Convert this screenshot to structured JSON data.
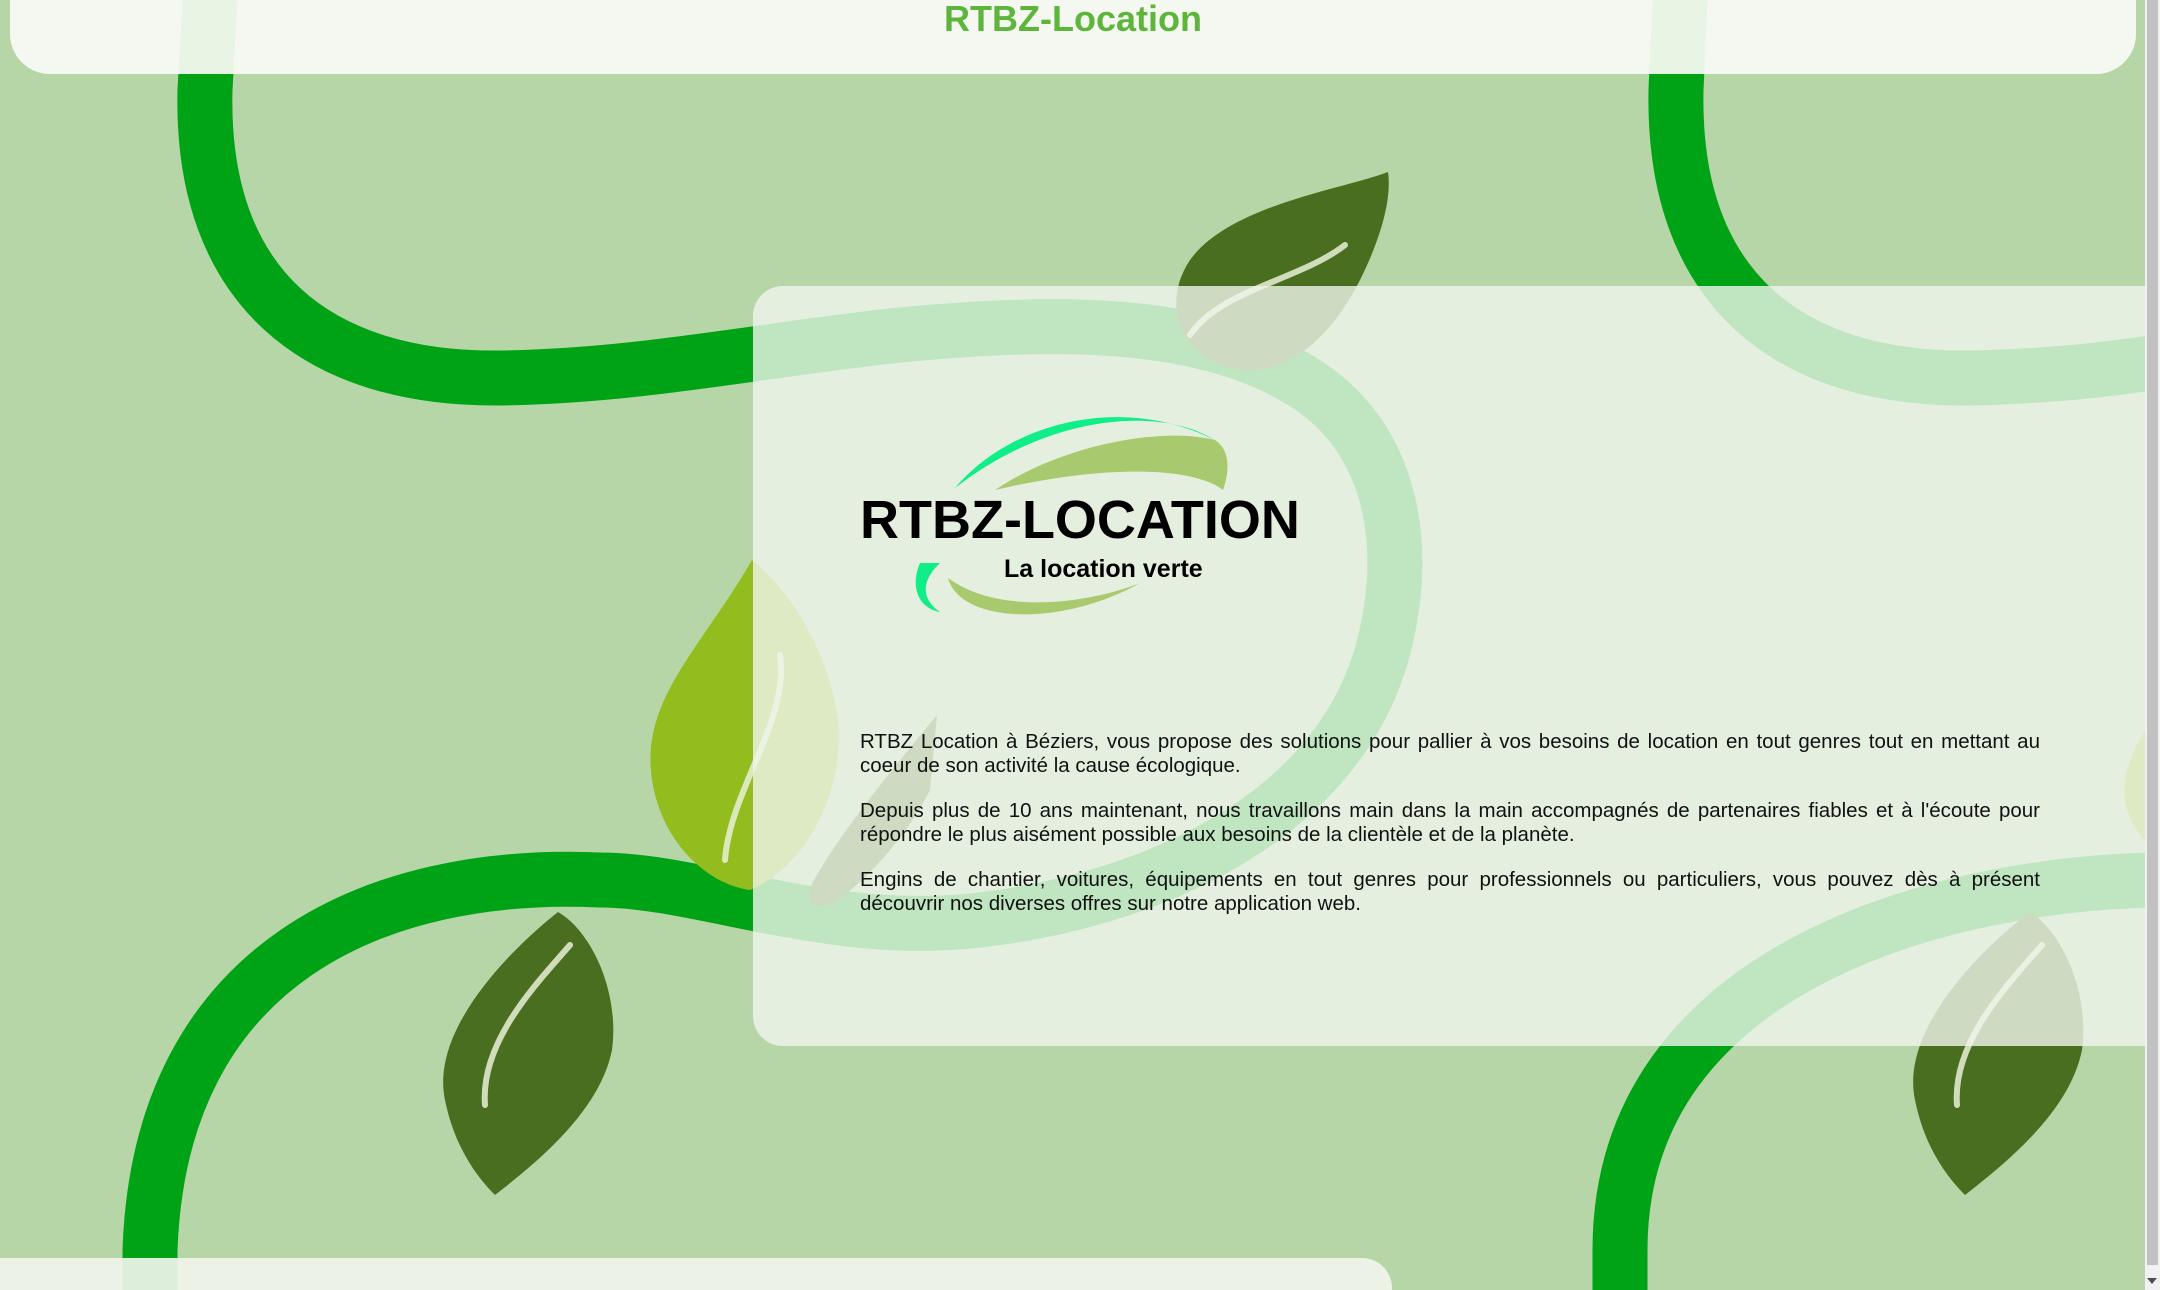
{
  "header": {
    "title": "RTBZ-Location"
  },
  "logo": {
    "name": "RTBZ-LOCATION",
    "tagline": "La location verte"
  },
  "intro": {
    "paragraphs": [
      "RTBZ Location à Béziers, vous propose des solutions pour pallier à vos besoins de location en tout genres tout en mettant au coeur de son activité la cause écologique.",
      "Depuis plus de 10 ans maintenant, nous travaillons main dans la main accompagnés de partenaires fiables et à l'écoute pour répondre le plus aisément possible aux besoins de la clientèle et de la planète.",
      "Engins de chantier, voitures, équipements en tout genres pour professionnels ou particuliers, vous pouvez dès à présent découvrir nos diverses offres sur notre application web."
    ]
  },
  "colors": {
    "background": "#b7d6a8",
    "vine": "#00a316",
    "leaf_dark": "#4a6e20",
    "leaf_light": "#93bd1e",
    "title_green": "#5db53c",
    "logo_swoosh_mint": "#10ee88",
    "logo_swoosh_olive": "#a9c96e"
  },
  "icons": {
    "logo": "swoosh-logo-icon",
    "decor": "leaf-vine-pattern"
  }
}
